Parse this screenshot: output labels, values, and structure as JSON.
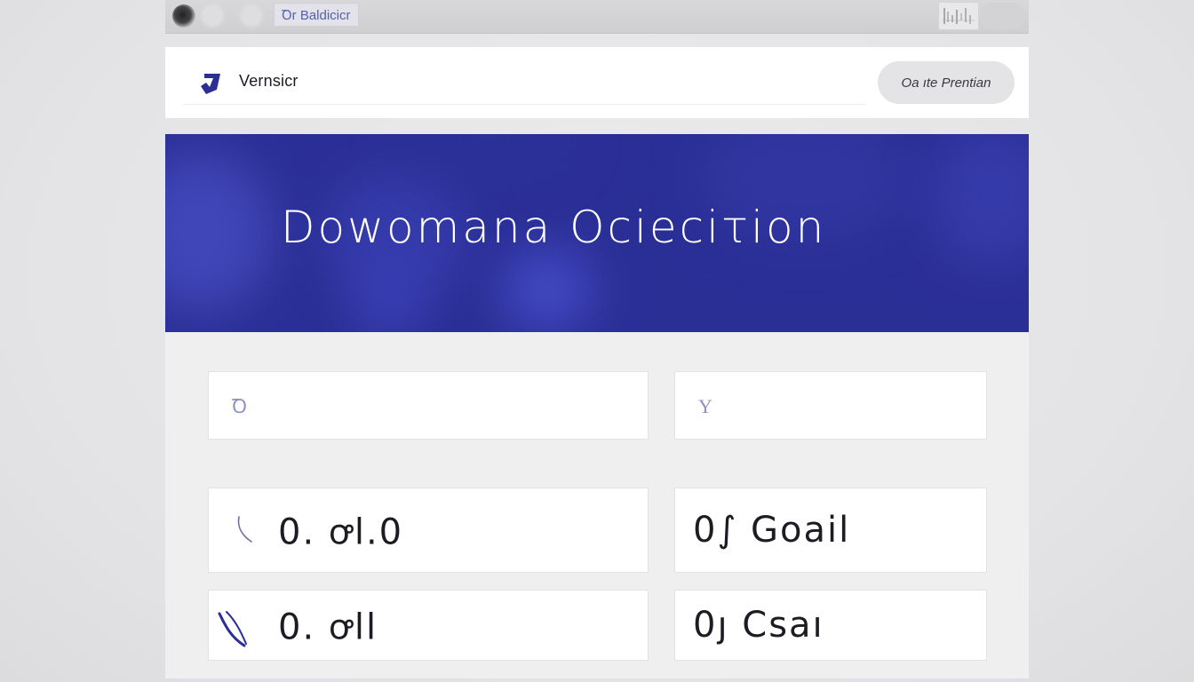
{
  "browser": {
    "tab_title": "Ꝺr Baldicicr"
  },
  "header": {
    "brand_name": "Vernsicr",
    "premium_button_label": "Oa ıte Prentian"
  },
  "hero": {
    "title": "Dowomana Ocieciτion"
  },
  "fields": {
    "left_placeholder": "Ꝺ",
    "right_placeholder": "Y"
  },
  "stats": [
    {
      "value": "0. ꝍl.0"
    },
    {
      "value": "0∫ Goail"
    },
    {
      "value": "0. ꝍll"
    },
    {
      "value": "0ȷ Csaı"
    }
  ],
  "colors": {
    "hero_background": "#2a2f96",
    "accent": "#2a2f96",
    "page_background": "#e6e6e8"
  }
}
